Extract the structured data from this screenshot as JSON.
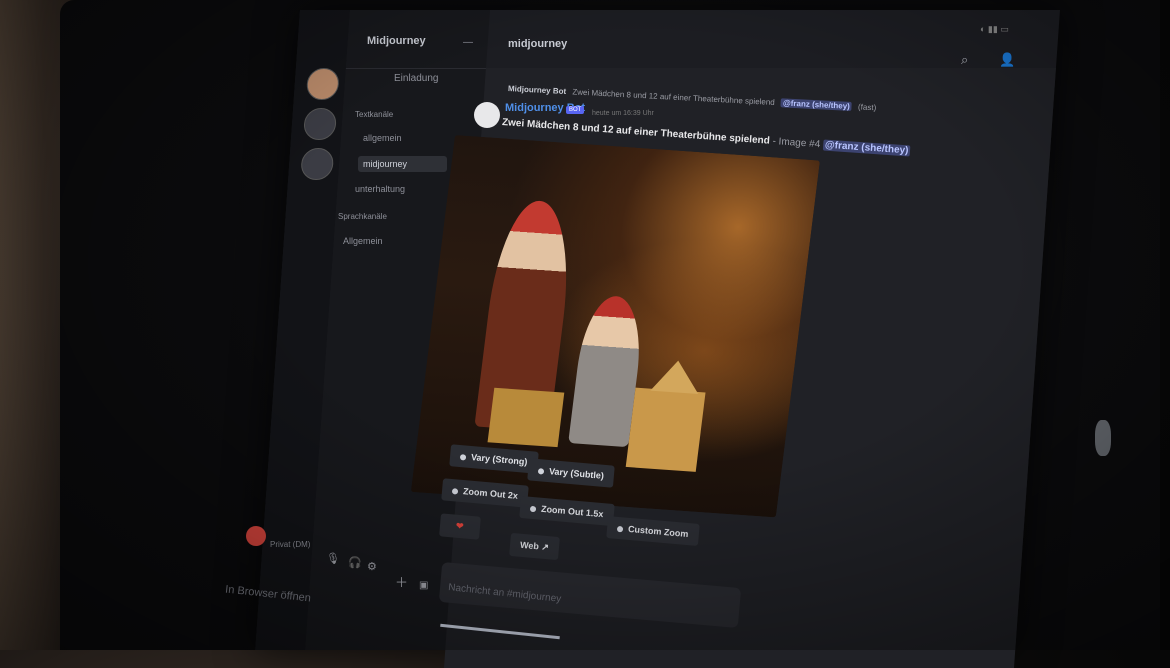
{
  "server": {
    "name": "Midjourney",
    "channel": "midjourney"
  },
  "sidebar": {
    "invite_label": "Einladung",
    "categories": [
      {
        "name": "Textkanäle",
        "channels": [
          "allgemein",
          "midjourney",
          "unterhaltung"
        ]
      },
      {
        "name": "Sprachkanäle",
        "channels": [
          "Allgemein"
        ]
      }
    ],
    "user_status": "Privat (DM)"
  },
  "message": {
    "reply_author": "Midjourney Bot",
    "reply_text": "Zwei Mädchen 8 und 12 auf einer Theaterbühne spielend",
    "reply_mention": "@franz (she/they)",
    "reply_suffix": "(fast)",
    "author": "Midjourney Bot",
    "badge": "BOT",
    "timestamp": "heute um 16:39 Uhr",
    "prompt": "Zwei Mädchen 8 und 12 auf einer Theaterbühne spielend",
    "image_label": "- Image #4",
    "mention": "@franz (she/they)"
  },
  "buttons": {
    "vary_strong": "Vary (Strong)",
    "vary_subtle": "Vary (Subtle)",
    "zoom_out_2x": "Zoom Out 2x",
    "zoom_out_15x": "Zoom Out 1.5x",
    "custom_zoom": "Custom Zoom",
    "favorite": "❤",
    "web": "Web ↗"
  },
  "composer": {
    "placeholder": "Nachricht an #midjourney"
  },
  "footer": {
    "offline_text": "In Browser öffnen"
  },
  "colors": {
    "accent": "#5865f2",
    "author": "#4f8fe8",
    "mention_bg": "#3c4370"
  },
  "icons": {
    "search": "search-icon",
    "members": "members-icon",
    "add": "plus-icon",
    "gif": "gif-icon"
  }
}
